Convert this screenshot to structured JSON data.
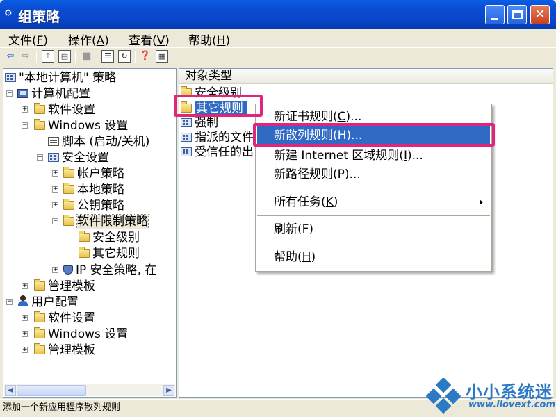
{
  "window": {
    "title": "组策略",
    "app_icon": "gpedit-icon",
    "buttons": {
      "minimize": "minimize-icon",
      "maximize": "maximize-icon",
      "close": "✕"
    }
  },
  "menu": [
    {
      "label": "文件(",
      "key": "F",
      "end": ")"
    },
    {
      "label": "操作(",
      "key": "A",
      "end": ")"
    },
    {
      "label": "查看(",
      "key": "V",
      "end": ")"
    },
    {
      "label": "帮助(",
      "key": "H",
      "end": ")"
    }
  ],
  "toolbar_icons": [
    "back-icon",
    "forward-icon",
    "up-folder-icon",
    "show-tree-icon",
    "delete-icon",
    "properties-icon",
    "refresh-icon",
    "export-icon",
    "help-icon",
    "console-icon"
  ],
  "tree": {
    "root": "\"本地计算机\" 策略",
    "computer_config": "计算机配置",
    "software_settings": "软件设置",
    "windows_settings": "Windows 设置",
    "scripts": "脚本 (启动/关机)",
    "security_settings": "安全设置",
    "account_policy": "帐户策略",
    "local_policy": "本地策略",
    "public_key_policy": "公钥策略",
    "software_restriction": "软件限制策略",
    "security_levels": "安全级别",
    "other_rules": "其它规则",
    "ip_security": "IP 安全策略, 在",
    "admin_templates": "管理模板",
    "user_config": "用户配置",
    "user_software_settings": "软件设置",
    "user_windows_settings": "Windows 设置",
    "user_admin_templates": "管理模板"
  },
  "list": {
    "column_header": "对象类型",
    "items": [
      "安全级别",
      "其它规则",
      "强制",
      "指派的文件",
      "受信任的出"
    ]
  },
  "context_menu": {
    "new_certificate_rule": "新证书规则(",
    "new_certificate_rule_key": "C",
    "new_certificate_rule_end": ")...",
    "new_hash_rule": "新散列规则(",
    "new_hash_rule_key": "H",
    "new_hash_rule_end": ")...",
    "new_internet_zone_rule": "新建 Internet 区域规则(",
    "new_internet_zone_rule_key": "I",
    "new_internet_zone_rule_end": ")...",
    "new_path_rule": "新路径规则(",
    "new_path_rule_key": "P",
    "new_path_rule_end": ")...",
    "all_tasks": "所有任务(",
    "all_tasks_key": "K",
    "all_tasks_end": ")",
    "refresh": "刷新(",
    "refresh_key": "F",
    "refresh_end": ")",
    "help": "帮助(",
    "help_key": "H",
    "help_end": ")"
  },
  "status_bar": {
    "text": "添加一个新应用程序散列规则"
  },
  "watermark": {
    "name": "小小系统迷",
    "url": "www.ilovext.com"
  },
  "colors": {
    "title_bar": "#0a4cd4",
    "selection": "#316ac5",
    "annotation_frame": "#e0267a",
    "watermark": "#2c79c6"
  }
}
